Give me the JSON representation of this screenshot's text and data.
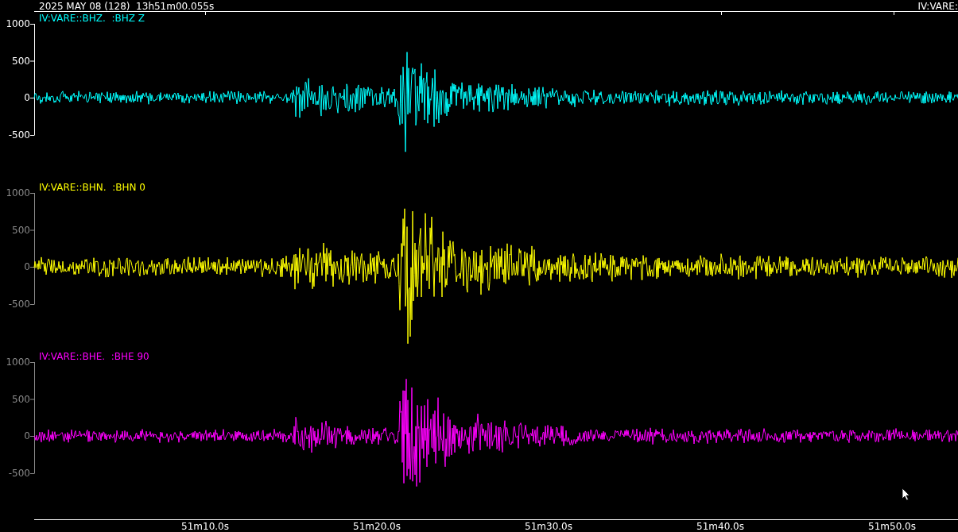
{
  "header": {
    "start_time": "2025 MAY 08 (128)  13h51m00.055s",
    "station": "IV:VARE:"
  },
  "traces": [
    {
      "label": "IV:VARE::BHZ.  :BHZ Z",
      "color": "#00ffff",
      "selected": true,
      "yticks": [
        "1000",
        "500",
        "0",
        "-500"
      ]
    },
    {
      "label": "IV:VARE::BHN.  :BHN 0",
      "color": "#ffff00",
      "selected": false,
      "yticks": [
        "1000",
        "500",
        "0",
        "-500"
      ]
    },
    {
      "label": "IV:VARE::BHE.  :BHE 90",
      "color": "#ff00ff",
      "selected": false,
      "yticks": [
        "1000",
        "500",
        "0",
        "-500"
      ]
    }
  ],
  "time_axis": {
    "ticks": [
      "51m10.0s",
      "51m20.0s",
      "51m30.0s",
      "51m40.0s",
      "51m50.0s"
    ]
  }
}
